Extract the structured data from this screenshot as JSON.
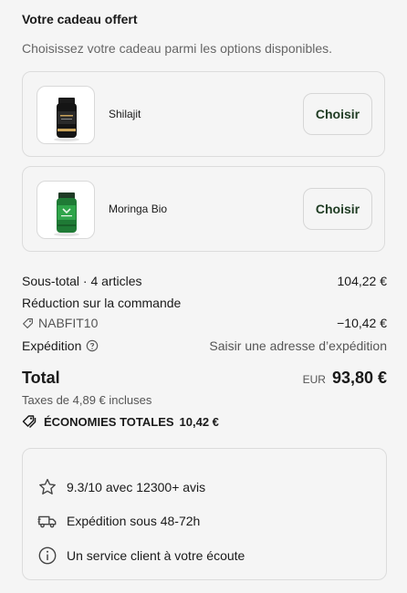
{
  "gift": {
    "title": "Votre cadeau offert",
    "subtitle": "Choisissez votre cadeau parmi les options disponibles.",
    "options": [
      {
        "name": "Shilajit",
        "button": "Choisir",
        "image_icon": "shilajit-bottle"
      },
      {
        "name": "Moringa Bio",
        "button": "Choisir",
        "image_icon": "moringa-bottle"
      }
    ]
  },
  "summary": {
    "subtotal_label": "Sous-total · 4 articles",
    "subtotal_value": "104,22 €",
    "discount_label": "Réduction sur la commande",
    "discount_code": "NABFIT10",
    "discount_value": "−10,42 €",
    "shipping_label": "Expédition",
    "shipping_value": "Saisir une adresse d’expédition",
    "total_label": "Total",
    "currency": "EUR",
    "total_value": "93,80 €",
    "taxes": "Taxes de 4,89 € incluses",
    "savings_label": "ÉCONOMIES TOTALES",
    "savings_value": "10,42 €"
  },
  "trust": {
    "items": [
      {
        "icon": "star-icon",
        "label": "9.3/10 avec 12300+ avis"
      },
      {
        "icon": "truck-icon",
        "label": "Expédition sous 48-72h"
      },
      {
        "icon": "info-icon",
        "label": "Un service client à votre écoute"
      }
    ]
  },
  "colors": {
    "button_text": "#1e3b22",
    "border": "#dcdcdc",
    "background": "#f5f5f5"
  }
}
